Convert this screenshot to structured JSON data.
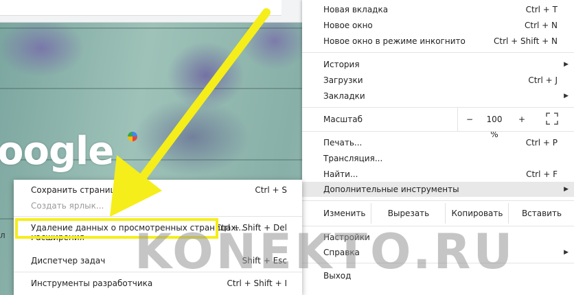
{
  "background": {
    "logo_text": "oogle",
    "partial_text": "л"
  },
  "main_menu": {
    "items": [
      {
        "label": "Новая вкладка",
        "shortcut": "Ctrl + T"
      },
      {
        "label": "Новое окно",
        "shortcut": "Ctrl + N"
      },
      {
        "label": "Новое окно в режиме инкогнито",
        "shortcut": "Ctrl + Shift + N"
      },
      {
        "label": "История",
        "shortcut": ""
      },
      {
        "label": "Загрузки",
        "shortcut": "Ctrl + J"
      },
      {
        "label": "Закладки",
        "shortcut": ""
      },
      {
        "label": "Печать...",
        "shortcut": "Ctrl + P"
      },
      {
        "label": "Трансляция...",
        "shortcut": ""
      },
      {
        "label": "Найти...",
        "shortcut": "Ctrl + F"
      },
      {
        "label": "Дополнительные инструменты",
        "shortcut": ""
      },
      {
        "label": "Настройки",
        "shortcut": ""
      },
      {
        "label": "Справка",
        "shortcut": ""
      },
      {
        "label": "Выход",
        "shortcut": ""
      }
    ],
    "zoom": {
      "label": "Масштаб",
      "minus": "−",
      "value": "100 %",
      "plus": "+"
    },
    "edit": {
      "label": "Изменить",
      "cut": "Вырезать",
      "copy": "Копировать",
      "paste": "Вставить"
    }
  },
  "sub_menu": {
    "items": [
      {
        "label": "Сохранить страницу как...",
        "shortcut": "Ctrl + S"
      },
      {
        "label": "Создать ярлык...",
        "shortcut": ""
      },
      {
        "label": "Удаление данных о просмотренных страницах...",
        "shortcut": "Ctrl + Shift + Del"
      },
      {
        "label": "Расширения",
        "shortcut": ""
      },
      {
        "label": "Диспетчер задач",
        "shortcut": "Shift + Esc"
      },
      {
        "label": "Инструменты разработчика",
        "shortcut": "Ctrl + Shift + I"
      }
    ]
  },
  "watermark": "KONEKTO.RU",
  "colors": {
    "highlight": "#f5ee1a",
    "hover": "#e8e8e8"
  }
}
